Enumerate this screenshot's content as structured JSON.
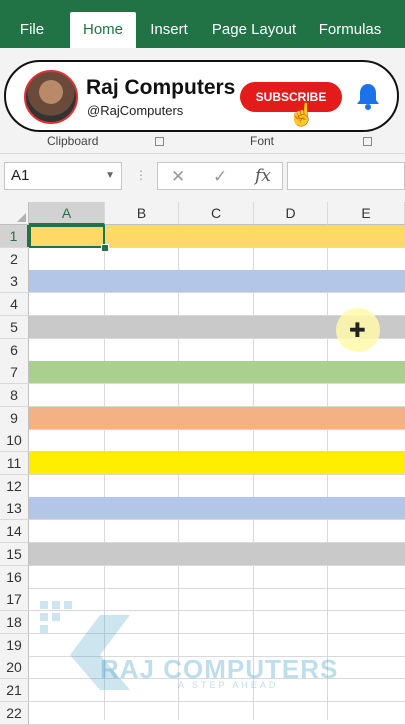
{
  "ribbon": {
    "tabs": [
      {
        "label": "File"
      },
      {
        "label": "Home"
      },
      {
        "label": "Insert"
      },
      {
        "label": "Page Layout"
      },
      {
        "label": "Formulas"
      }
    ],
    "active_tab": "Home",
    "group_labels": [
      "Clipboard",
      "Font"
    ]
  },
  "overlay": {
    "channel_name": "Raj Computers",
    "handle": "@RajComputers",
    "subscribe_label": "SUBSCRIBE"
  },
  "formula_bar": {
    "name_box": "A1",
    "formula": ""
  },
  "sheet": {
    "columns": [
      "A",
      "B",
      "C",
      "D",
      "E"
    ],
    "rows": [
      "1",
      "2",
      "3",
      "4",
      "5",
      "6",
      "7",
      "8",
      "9",
      "10",
      "11",
      "12",
      "13",
      "14",
      "15",
      "16",
      "17",
      "18",
      "19",
      "20",
      "21",
      "22"
    ],
    "row_fills": {
      "1": "#ffd966",
      "3": "#b4c6e7",
      "5": "#c9c9c9",
      "7": "#a9d08e",
      "9": "#f4b183",
      "11": "#ffee00",
      "13": "#b4c6e7",
      "15": "#c9c9c9"
    },
    "selected_cell": "A1"
  },
  "watermark": {
    "text": "RAJ COMPUTERS",
    "tagline": "A STEP AHEAD"
  },
  "colors": {
    "excel_green": "#217346"
  }
}
